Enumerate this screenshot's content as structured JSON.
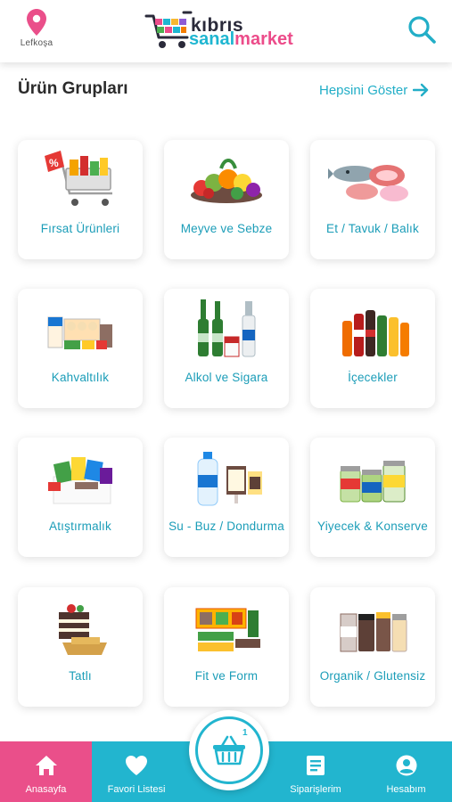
{
  "header": {
    "location_label": "Lefkoşa",
    "logo_top": "kıbrıs",
    "logo_sanal": "sanal",
    "logo_market": "market",
    "location_icon": "map-pin-icon",
    "search_icon": "search-icon"
  },
  "section": {
    "title": "Ürün Grupları",
    "show_all": "Hepsini Göster"
  },
  "categories": [
    {
      "label": "Fırsat Ürünleri",
      "icon": "discount-cart-image"
    },
    {
      "label": "Meyve ve Sebze",
      "icon": "fruit-vegetable-image"
    },
    {
      "label": "Et / Tavuk / Balık",
      "icon": "meat-fish-image"
    },
    {
      "label": "Kahvaltılık",
      "icon": "breakfast-image"
    },
    {
      "label": "Alkol ve Sigara",
      "icon": "alcohol-image"
    },
    {
      "label": "İçecekler",
      "icon": "drinks-image"
    },
    {
      "label": "Atıştırmalık",
      "icon": "snacks-image"
    },
    {
      "label": "Su - Buz / Dondurma",
      "icon": "water-icecream-image"
    },
    {
      "label": "Yiyecek & Konserve",
      "icon": "canned-food-image"
    },
    {
      "label": "Tatlı",
      "icon": "dessert-image"
    },
    {
      "label": "Fit ve Form",
      "icon": "fitness-bars-image"
    },
    {
      "label": "Organik / Glutensiz",
      "icon": "organic-jars-image"
    }
  ],
  "bottom_nav": {
    "home": "Anasayfa",
    "favorites": "Favori Listesi",
    "orders": "Siparişlerim",
    "account": "Hesabım",
    "basket_count": "1"
  },
  "colors": {
    "accent": "#22b5cf",
    "brand_pink": "#ea4f8a",
    "label_text": "#1b9db8"
  }
}
